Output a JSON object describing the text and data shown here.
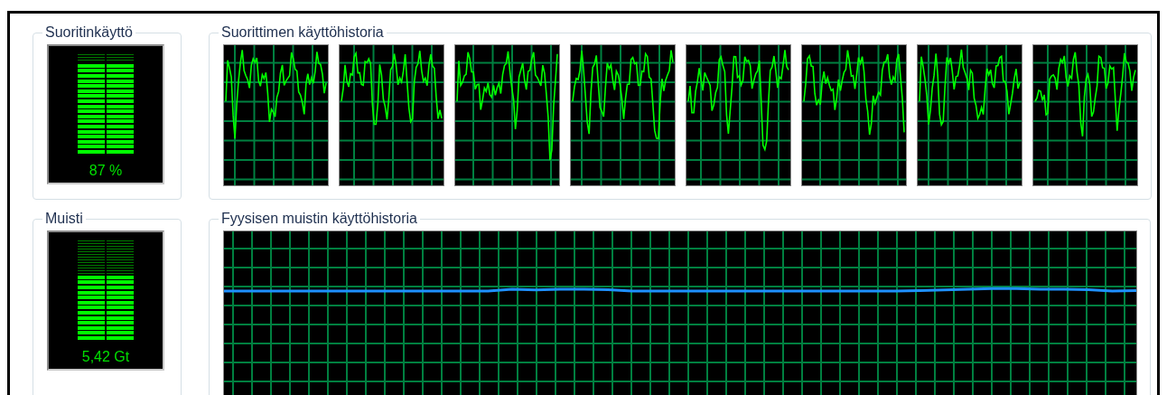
{
  "cpu_usage": {
    "title": "Suoritinkäyttö",
    "level": 0.9,
    "reading": "87 %"
  },
  "cpu_history": {
    "title": "Suorittimen käyttöhistoria",
    "graphs": [
      {
        "kind": "cpu-graph"
      },
      {
        "kind": "cpu-graph"
      },
      {
        "kind": "cpu-graph"
      },
      {
        "kind": "cpu-graph"
      },
      {
        "kind": "cpu-graph"
      },
      {
        "kind": "cpu-graph"
      },
      {
        "kind": "cpu-graph"
      },
      {
        "kind": "cpu-graph"
      }
    ]
  },
  "memory": {
    "title": "Muisti",
    "level": 0.65,
    "reading": "5,42 Gt"
  },
  "memory_history": {
    "title": "Fyysisen muistin käyttöhistoria",
    "graphs": [
      {
        "kind": "memory-graph"
      }
    ]
  }
}
